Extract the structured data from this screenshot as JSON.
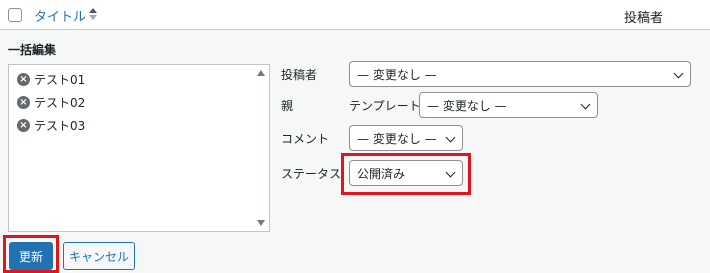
{
  "header": {
    "title_label": "タイトル",
    "author_label": "投稿者"
  },
  "bulk_edit": {
    "title": "一括編集",
    "items": [
      {
        "label": "テスト01"
      },
      {
        "label": "テスト02"
      },
      {
        "label": "テスト03"
      }
    ]
  },
  "fields": {
    "author": {
      "label": "投稿者",
      "value": "— 変更なし —"
    },
    "parent": {
      "label": "親",
      "template_label": "テンプレート",
      "value": "— 変更なし —"
    },
    "comment": {
      "label": "コメント",
      "value": "— 変更なし —"
    },
    "status": {
      "label": "ステータス",
      "value": "公開済み"
    }
  },
  "buttons": {
    "update": "更新",
    "cancel": "キャンセル"
  },
  "colors": {
    "accent": "#2271b1",
    "highlight": "#e0161e"
  }
}
